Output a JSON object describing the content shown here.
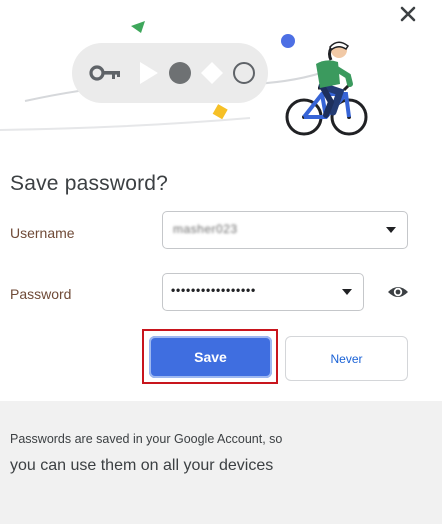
{
  "dialog": {
    "title": "Save password?",
    "close_icon": "close-icon"
  },
  "form": {
    "username_label": "Username",
    "username_value": "masher023",
    "password_label": "Password",
    "password_value": "•••••••••••••••••",
    "eye_icon": "eye-icon"
  },
  "actions": {
    "save_label": "Save",
    "never_label": "Never"
  },
  "footer": {
    "line1": "Passwords are saved in your Google Account, so",
    "line2": "you can use them on all your devices"
  },
  "colors": {
    "primary": "#3f6ee0",
    "link": "#1a62d6",
    "highlight": "#c8151d",
    "label": "#6f4a37",
    "footer_bg": "#f1f1f1"
  }
}
